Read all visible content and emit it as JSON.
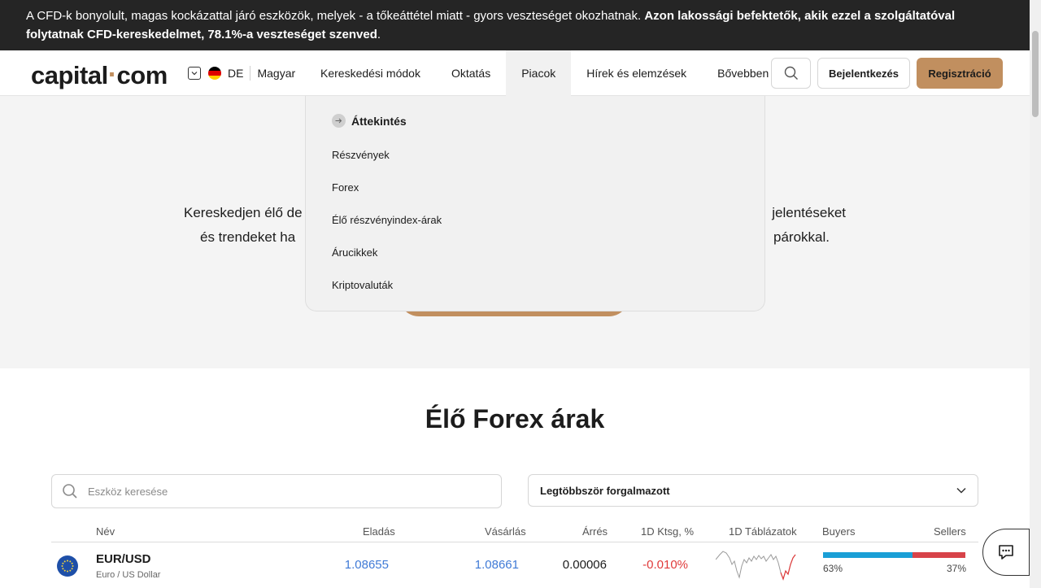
{
  "risk_banner": {
    "text": "A CFD-k bonyolult, magas kockázattal járó eszközök, melyek - a tőkeáttétel miatt - gyors veszteséget okozhatnak. ",
    "bold": "Azon lakossági befektetők, akik ezzel a szolgáltatóval folytatnak CFD-kereskedelmet, 78.1%-a veszteséget szenved",
    "end": "."
  },
  "header": {
    "logo_left": "capital",
    "logo_dot": "·",
    "logo_right": "com",
    "lang_code": "DE",
    "lang_name": "Magyar",
    "nav": [
      "Kereskedési módok",
      "Oktatás",
      "Piacok",
      "Hírek és elemzések",
      "Bővebben"
    ],
    "login": "Bejelentkezés",
    "register": "Regisztráció"
  },
  "dropdown": {
    "overview": "Áttekintés",
    "items": [
      "Részvények",
      "Forex",
      "Élő részvényindex-árak",
      "Árucikkek",
      "Kriptovaluták"
    ]
  },
  "hero": {
    "line1_left": "Kereskedjen élő de",
    "line1_right": "jelentéseket",
    "line2_left": "és trendeket ha",
    "line2_right": "párokkal."
  },
  "forex": {
    "title": "Élő Forex árak",
    "search_placeholder": "Eszköz keresése",
    "sort_value": "Legtöbbször forgalmazott",
    "headers": {
      "name": "Név",
      "sell": "Eladás",
      "buy": "Vásárlás",
      "spread": "Árrés",
      "change": "1D Ktsg, %",
      "chart": "1D Táblázatok",
      "buyers": "Buyers",
      "sellers": "Sellers"
    },
    "rows": [
      {
        "symbol": "EUR/USD",
        "full_name": "Euro / US Dollar",
        "sell": "1.08655",
        "buy": "1.08661",
        "spread": "0.00006",
        "change": "-0.010%",
        "buyers_pct": "63%",
        "sellers_pct": "37%",
        "buyers_share": 63,
        "sellers_share": 37
      }
    ]
  },
  "colors": {
    "accent": "#c18f5f",
    "banner_bg": "#252525",
    "price_blue": "#3f7ad6",
    "negative": "#e03a3a",
    "buyers_bar": "#1a9fd6",
    "sellers_bar": "#d74349"
  },
  "icons": {
    "search": "search-icon",
    "chevron": "chevron-down-icon",
    "chat": "chat-icon",
    "arrow": "arrow-right-icon",
    "flag": "germany-flag-icon",
    "eu": "eu-flag-icon"
  }
}
